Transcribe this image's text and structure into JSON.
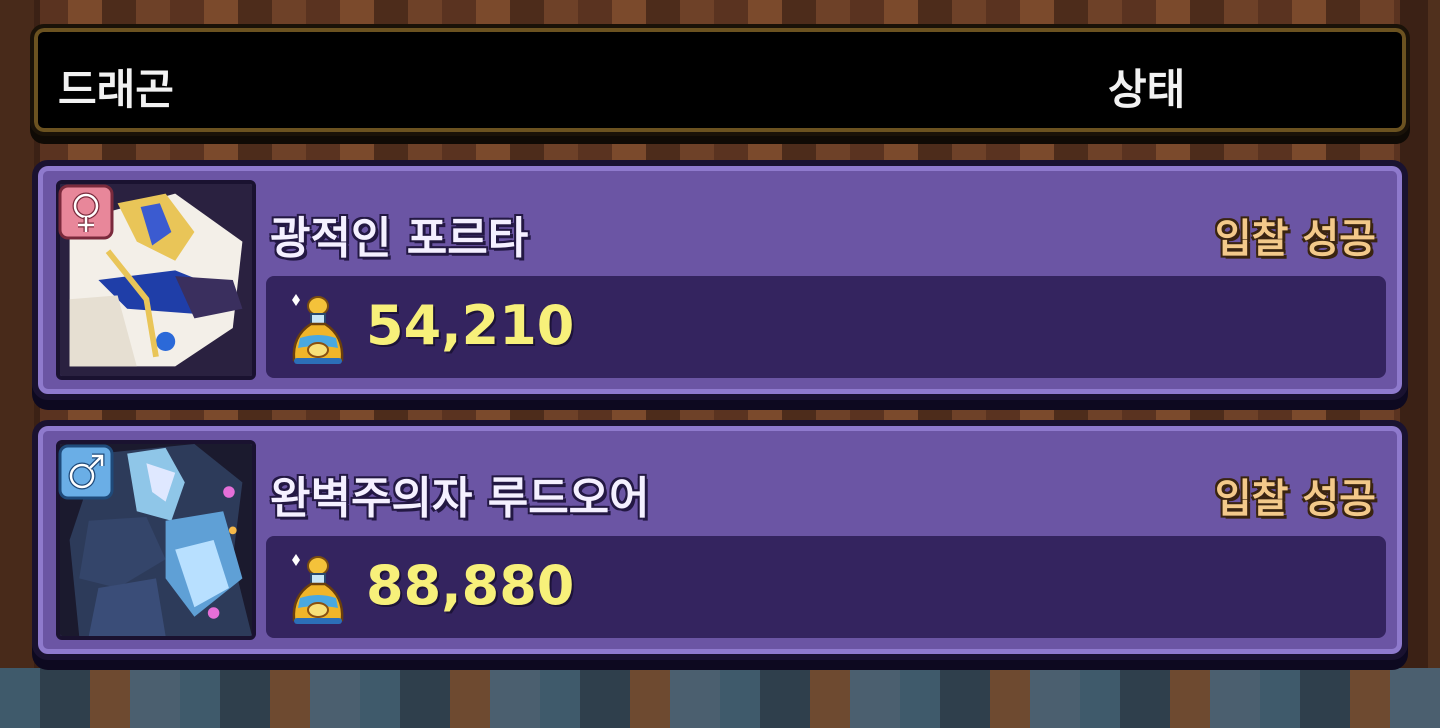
{
  "header": {
    "col_dragon": "드래곤",
    "col_status": "상태"
  },
  "listings": [
    {
      "gender": "female",
      "gender_icon": "female-symbol-icon",
      "name": "광적인 포르타",
      "status": "입찰 성공",
      "price": "54,210",
      "currency_icon": "gold-potion-icon"
    },
    {
      "gender": "male",
      "gender_icon": "male-symbol-icon",
      "name": "완벽주의자 루드오어",
      "status": "입찰 성공",
      "price": "88,880",
      "currency_icon": "gold-potion-icon"
    }
  ],
  "colors": {
    "card": "#6b55a4",
    "price_bar": "#34245f",
    "price_text": "#f7f07a",
    "status_text": "#f3c98a",
    "female_badge": "#e8879a",
    "male_badge": "#6aaee6"
  }
}
